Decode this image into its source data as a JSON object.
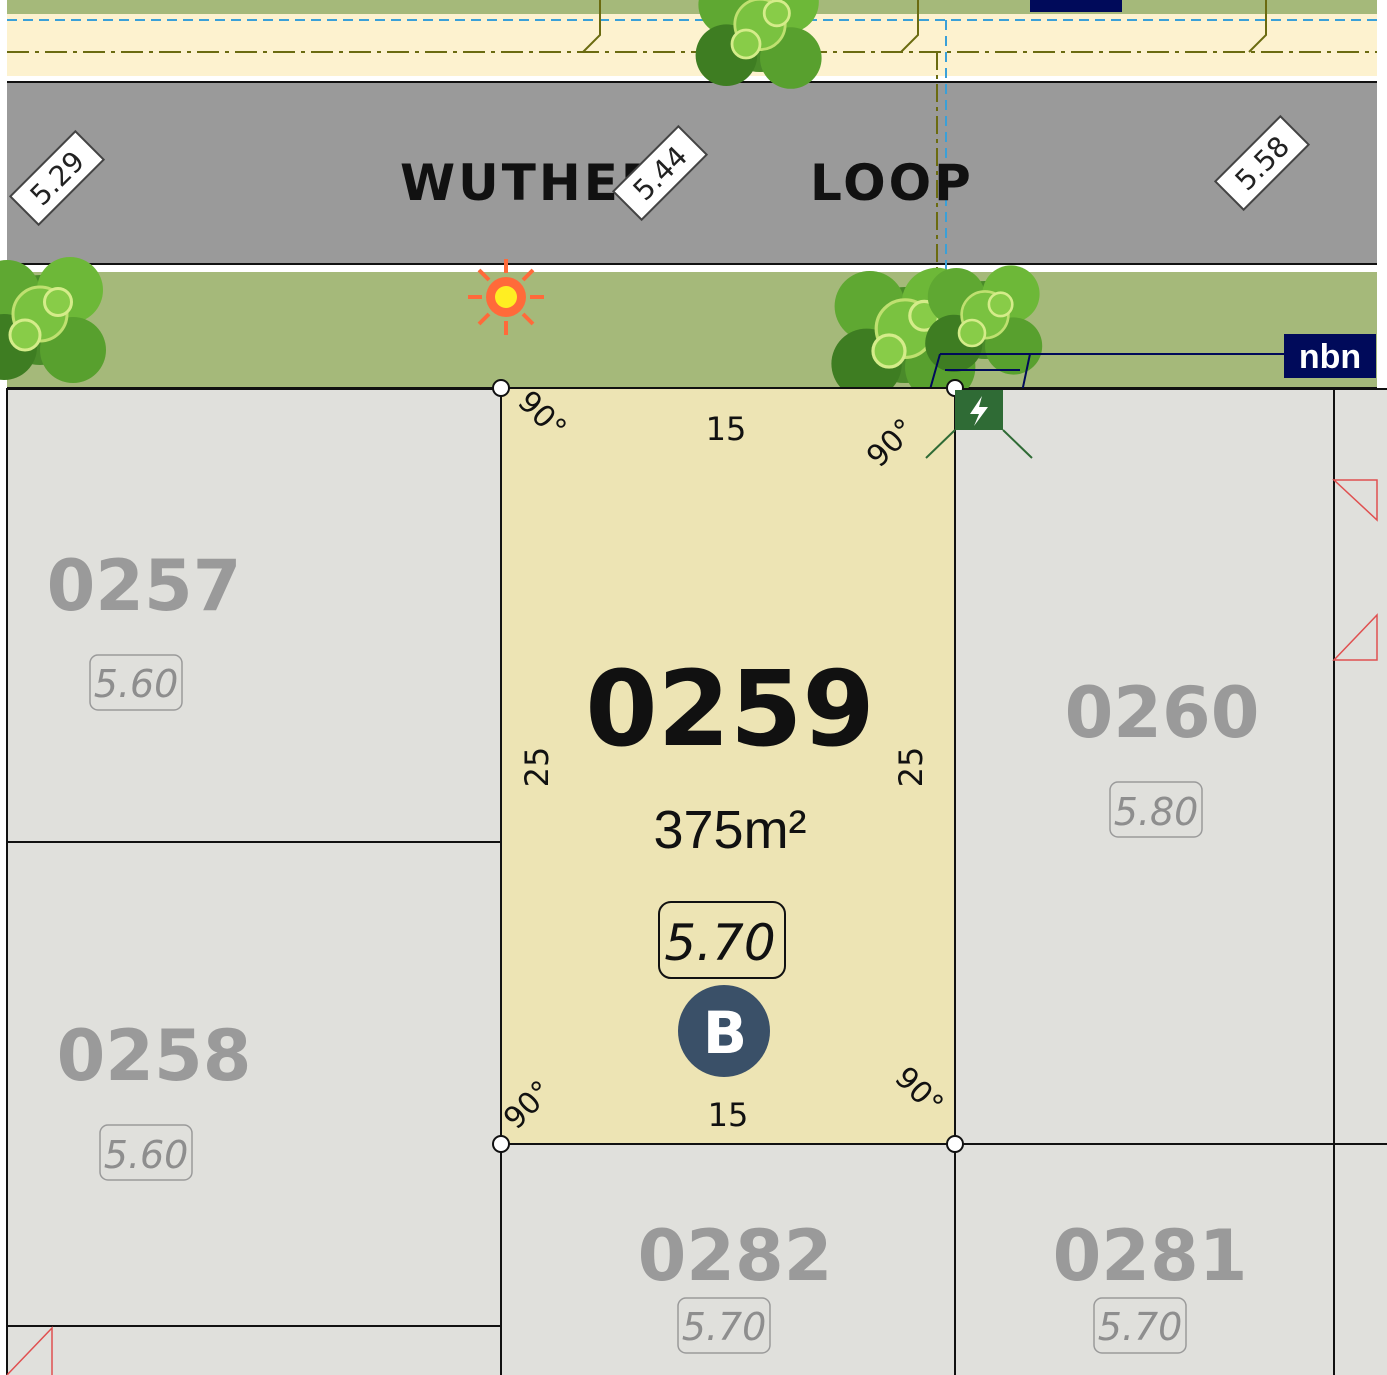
{
  "road": {
    "name_part1": "WUTHER",
    "name_part2": "LOOP",
    "levels": [
      "5.29",
      "5.44",
      "5.58"
    ]
  },
  "selected_lot": {
    "number": "0259",
    "area": "375m²",
    "level": "5.70",
    "badge": "B",
    "frontage": "15",
    "rear": "15",
    "left_depth": "25",
    "right_depth": "25",
    "angle_label": "90°"
  },
  "lots": [
    {
      "number": "0257",
      "level": "5.60"
    },
    {
      "number": "0258",
      "level": "5.60"
    },
    {
      "number": "0260",
      "level": "5.80"
    },
    {
      "number": "0282",
      "level": "5.70"
    },
    {
      "number": "0281",
      "level": "5.70"
    }
  ],
  "nbn_label": "nbn",
  "colors": {
    "road": "#9a9a9a",
    "verge": "#a5b97a",
    "selected_lot": "#ede4b4",
    "other_lots": "#e0e0dc",
    "badge": "#3a5068",
    "nbn_box": "#000a5a",
    "retaining_wall": "#b45a00",
    "transformer": "#2f6b35",
    "streetlight": "#ff6a3a"
  },
  "icons": [
    "street-light-icon",
    "transformer-icon",
    "tree-icon",
    "nbn-pit-icon"
  ]
}
